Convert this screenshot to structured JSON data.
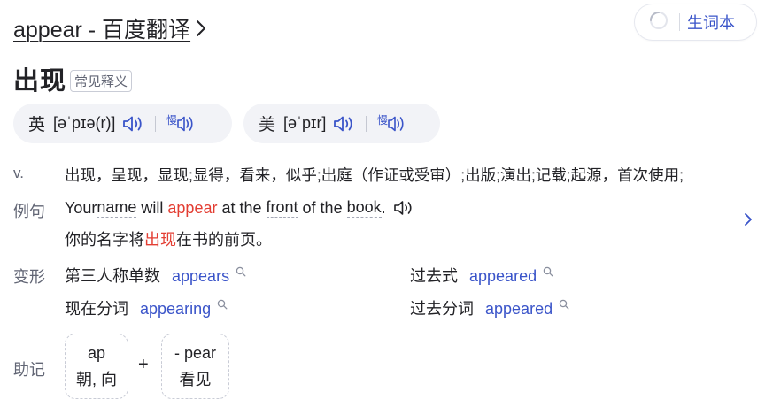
{
  "header": {
    "title": "appear - 百度翻译",
    "vocab_button_label": "生词本"
  },
  "headword": {
    "text": "出现",
    "tag": "常见释义"
  },
  "pronunciations": [
    {
      "region": "英",
      "ipa": "[əˈpɪə(r)]",
      "speaker_icon": "speaker-icon",
      "follow_icon": "follow-read-icon"
    },
    {
      "region": "美",
      "ipa": "[əˈpɪr]",
      "speaker_icon": "speaker-icon",
      "follow_icon": "follow-read-icon"
    }
  ],
  "definition": {
    "pos": "v.",
    "text": "出现，呈现，显现;显得，看来，似乎;出庭（作证或受审）;出版;演出;记载;起源，首次使用;"
  },
  "example": {
    "label": "例句",
    "en": {
      "p1": "Your ",
      "w1": "name",
      "p2": " will ",
      "hl": "appear",
      "p3": " at the ",
      "w2": "front",
      "p4": " of the ",
      "w3": "book",
      "p5": "."
    },
    "zh": {
      "p1": "你的名字将",
      "hl": "出现",
      "p2": "在书的前页。"
    }
  },
  "inflections": {
    "label": "变形",
    "items": [
      {
        "type": "第三人称单数",
        "word": "appears"
      },
      {
        "type": "过去式",
        "word": "appeared"
      },
      {
        "type": "现在分词",
        "word": "appearing"
      },
      {
        "type": "过去分词",
        "word": "appeared"
      }
    ]
  },
  "mnemonic": {
    "label": "助记",
    "parts": [
      {
        "morpheme": "ap",
        "meaning": "朝, 向"
      },
      {
        "morpheme": "- pear",
        "meaning": "看见"
      }
    ],
    "plus": "+"
  },
  "colors": {
    "accent_blue": "#3a54c9",
    "highlight_red": "#e33e33",
    "label_gray": "#626675",
    "pron_bg": "#f2f3f7"
  }
}
